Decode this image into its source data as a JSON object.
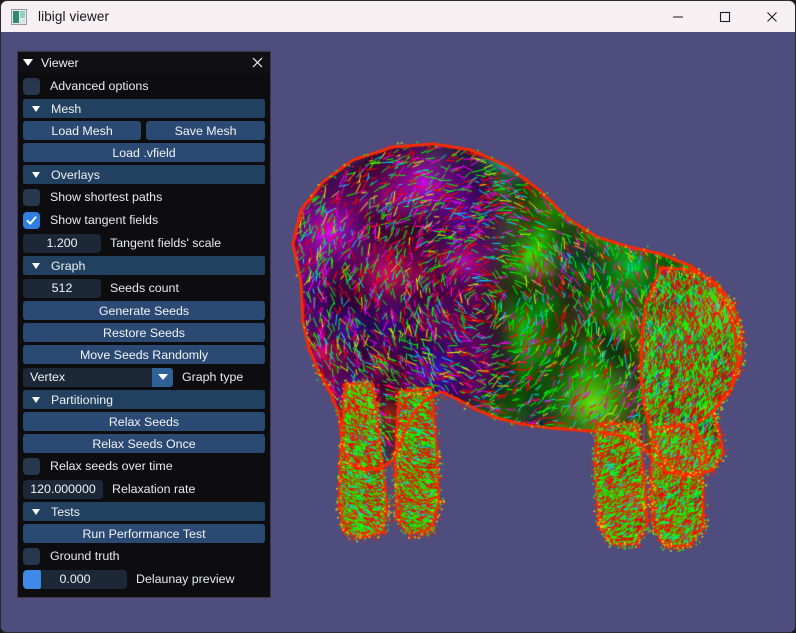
{
  "window": {
    "title": "libigl viewer",
    "icon": "app-icon",
    "controls": {
      "minimize": "minimize-icon",
      "maximize": "maximize-icon",
      "close": "close-icon"
    },
    "viewport_bg": "#4e4d7e"
  },
  "panel": {
    "title": "Viewer",
    "close_icon": "close-icon",
    "collapse_icon": "triangle-down-icon",
    "advanced_options": {
      "label": "Advanced options",
      "checked": false
    },
    "mesh": {
      "header": "Mesh",
      "load_mesh": "Load Mesh",
      "save_mesh": "Save Mesh",
      "load_vfield": "Load .vfield"
    },
    "overlays": {
      "header": "Overlays",
      "show_shortest_paths": {
        "label": "Show shortest paths",
        "checked": false
      },
      "show_tangent_fields": {
        "label": "Show tangent fields",
        "checked": true
      },
      "tangent_scale": {
        "value": "1.200",
        "label": "Tangent fields' scale"
      }
    },
    "graph": {
      "header": "Graph",
      "seeds_count": {
        "value": "512",
        "label": "Seeds count"
      },
      "generate_seeds": "Generate Seeds",
      "restore_seeds": "Restore Seeds",
      "move_seeds_randomly": "Move Seeds Randomly",
      "graph_type": {
        "value": "Vertex",
        "label": "Graph type"
      }
    },
    "partitioning": {
      "header": "Partitioning",
      "relax_seeds": "Relax Seeds",
      "relax_seeds_once": "Relax Seeds Once",
      "relax_over_time": {
        "label": "Relax seeds over time",
        "checked": false
      },
      "relaxation_rate": {
        "value": "120.000000",
        "label": "Relaxation rate"
      }
    },
    "tests": {
      "header": "Tests",
      "run_performance_test": "Run Performance Test",
      "ground_truth": {
        "label": "Ground truth",
        "checked": false
      },
      "delaunay_preview": {
        "value": "0.000",
        "label": "Delaunay preview"
      }
    },
    "colors": {
      "panel_bg": "#0d0d0f",
      "button": "#2a4a74",
      "header": "#22405f",
      "input": "#1c2738",
      "accent": "#2f7fe3"
    }
  }
}
